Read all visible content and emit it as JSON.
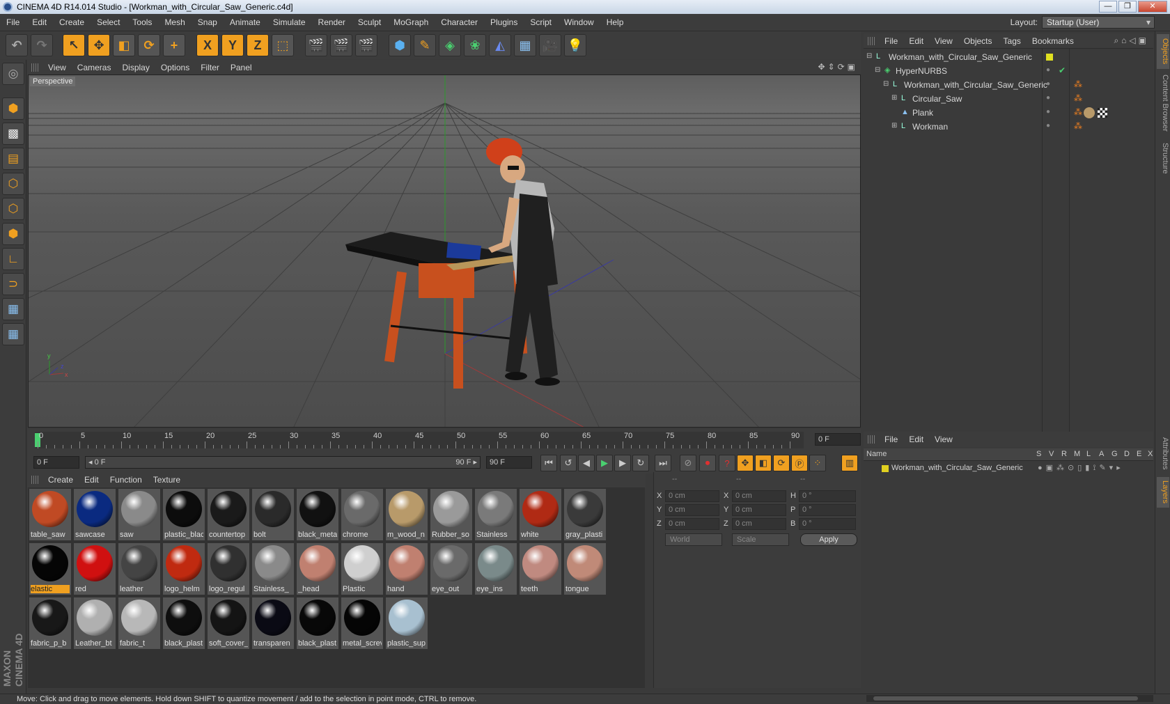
{
  "window": {
    "title": "CINEMA 4D R14.014 Studio - [Workman_with_Circular_Saw_Generic.c4d]",
    "buttons": [
      "—",
      "❐",
      "✕"
    ]
  },
  "menubar": {
    "items": [
      "File",
      "Edit",
      "Create",
      "Select",
      "Tools",
      "Mesh",
      "Snap",
      "Animate",
      "Simulate",
      "Render",
      "Sculpt",
      "MoGraph",
      "Character",
      "Plugins",
      "Script",
      "Window",
      "Help"
    ],
    "layout_label": "Layout:",
    "layout_value": "Startup (User)"
  },
  "toolbar": {
    "axis_x": "X",
    "axis_y": "Y",
    "axis_z": "Z"
  },
  "viewport": {
    "menu": [
      "View",
      "Cameras",
      "Display",
      "Options",
      "Filter",
      "Panel"
    ],
    "label": "Perspective",
    "axis_labels": {
      "y": "y",
      "z": "z",
      "x": "x"
    }
  },
  "timeline": {
    "ticks": [
      "0",
      "5",
      "10",
      "15",
      "20",
      "25",
      "30",
      "35",
      "40",
      "45",
      "50",
      "55",
      "60",
      "65",
      "70",
      "75",
      "80",
      "85",
      "90"
    ],
    "current_frame": "0 F"
  },
  "transport": {
    "start": "0 F",
    "range_start": "◂ 0 F",
    "range_end": "90 F ▸",
    "end": "90 F"
  },
  "material_manager": {
    "menu": [
      "Create",
      "Edit",
      "Function",
      "Texture"
    ],
    "materials": [
      {
        "name": "table_saw",
        "color": "#c04a24"
      },
      {
        "name": "sawcase",
        "color": "#0a2a80"
      },
      {
        "name": "saw",
        "color": "#8a8a8a"
      },
      {
        "name": "plastic_blac",
        "color": "#0c0c0c"
      },
      {
        "name": "countertop",
        "color": "#1a1a1a"
      },
      {
        "name": "bolt",
        "color": "#2a2a2a"
      },
      {
        "name": "black_meta",
        "color": "#111111"
      },
      {
        "name": "chrome",
        "color": "#6a6a6a"
      },
      {
        "name": "m_wood_n",
        "color": "#b89a6a"
      },
      {
        "name": "Rubber_so",
        "color": "#9a9a9a"
      },
      {
        "name": "Stainless",
        "color": "#7a7a7a"
      },
      {
        "name": "white",
        "color": "#b02a14"
      },
      {
        "name": "gray_plasti",
        "color": "#3a3a3a"
      },
      {
        "name": "elastic",
        "color": "#050505"
      },
      {
        "name": "red",
        "color": "#d01010"
      },
      {
        "name": "leather",
        "color": "#444444"
      },
      {
        "name": "logo_helm",
        "color": "#c02a10"
      },
      {
        "name": "logo_regul",
        "color": "#303030"
      },
      {
        "name": "Stainless_",
        "color": "#8a8a8a"
      },
      {
        "name": "_head",
        "color": "#c08070"
      },
      {
        "name": "Plastic",
        "color": "#cfcfcf"
      },
      {
        "name": "hand",
        "color": "#c08070"
      },
      {
        "name": "eye_out",
        "color": "#6a6a6a"
      },
      {
        "name": "eye_ins",
        "color": "#7a8a8a"
      },
      {
        "name": "teeth",
        "color": "#c08a80"
      },
      {
        "name": "tongue",
        "color": "#c08a78"
      },
      {
        "name": "fabric_p_b",
        "color": "#181818"
      },
      {
        "name": "Leather_bt",
        "color": "#b0b0b0"
      },
      {
        "name": "fabric_t",
        "color": "#b8b8b8"
      },
      {
        "name": "black_plast",
        "color": "#0e0e0e"
      },
      {
        "name": "soft_cover_",
        "color": "#141414"
      },
      {
        "name": "transparen",
        "color": "#0a0a14"
      },
      {
        "name": "black_plast",
        "color": "#080808"
      },
      {
        "name": "metal_screv",
        "color": "#050505"
      },
      {
        "name": "plastic_sup",
        "color": "#a8c0d0"
      }
    ],
    "selected": "elastic"
  },
  "coordinates": {
    "header": [
      "--",
      "--",
      "--"
    ],
    "rows": [
      {
        "a": "X",
        "av": "0 cm",
        "b": "X",
        "bv": "0 cm",
        "c": "H",
        "cv": "0 °"
      },
      {
        "a": "Y",
        "av": "0 cm",
        "b": "Y",
        "bv": "0 cm",
        "c": "P",
        "cv": "0 °"
      },
      {
        "a": "Z",
        "av": "0 cm",
        "b": "Z",
        "bv": "0 cm",
        "c": "B",
        "cv": "0 °"
      }
    ],
    "mode": "World",
    "transform": "Scale",
    "apply": "Apply"
  },
  "objects": {
    "menu": [
      "File",
      "Edit",
      "View",
      "Objects",
      "Tags",
      "Bookmarks"
    ],
    "tree": [
      {
        "name": "Workman_with_Circular_Saw_Generic",
        "level": 0,
        "icon": "null-object-icon"
      },
      {
        "name": "HyperNURBS",
        "level": 1,
        "icon": "hypernurbs-icon"
      },
      {
        "name": "Workman_with_Circular_Saw_Generic",
        "level": 2,
        "icon": "null-object-icon"
      },
      {
        "name": "Circular_Saw",
        "level": 3,
        "icon": "null-object-icon"
      },
      {
        "name": "Plank",
        "level": 3,
        "icon": "polygon-object-icon"
      },
      {
        "name": "Workman",
        "level": 3,
        "icon": "null-object-icon"
      }
    ]
  },
  "layers": {
    "menu": [
      "File",
      "Edit",
      "View"
    ],
    "columns": [
      "Name",
      "S",
      "V",
      "R",
      "M",
      "L",
      "A",
      "G",
      "D",
      "E",
      "X"
    ],
    "rows": [
      {
        "name": "Workman_with_Circular_Saw_Generic",
        "color": "#e0d020"
      }
    ]
  },
  "right_tabs": [
    "Objects",
    "Content Browser",
    "Structure",
    "Attributes",
    "Layers"
  ],
  "statusbar": {
    "text": "Move: Click and drag to move elements. Hold down SHIFT to quantize movement / add to the selection in point mode, CTRL to remove."
  },
  "logo": {
    "line1": "MAXON",
    "line2": "CINEMA 4D"
  }
}
